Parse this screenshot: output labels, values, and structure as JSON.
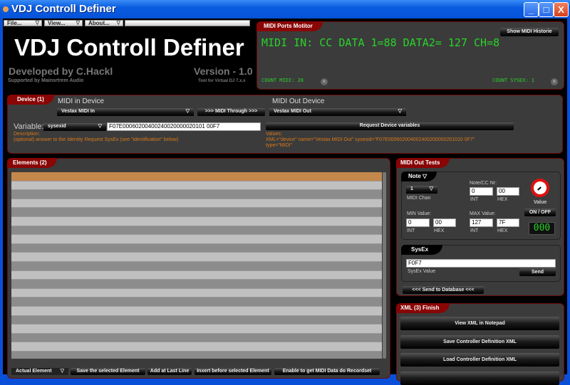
{
  "window": {
    "title": "VDJ Controll Definer",
    "minimize": "_",
    "maximize": "□",
    "close": "X"
  },
  "menu": {
    "items": [
      {
        "label": "File..."
      },
      {
        "label": "View..."
      },
      {
        "label": "About..."
      }
    ],
    "arrow": "▽"
  },
  "header": {
    "title": "VDJ Controll Definer",
    "developer": "Developed by C.Hackl",
    "version": "Version - 1.0",
    "supported": "Supported by Mainsrtrem Audio",
    "tool": "Tool for Virtual DJ 7.x.x"
  },
  "monitor": {
    "tab": "MIDI Ports Motitor",
    "history_button": "Show MIDI Historie",
    "lcd_text": "MIDI IN: CC DATA 1=88 DATA2= 127 CH=8",
    "count_midi": "COUNT MIDI: 28",
    "count_sysex": "COUNT SYSEX: 1",
    "clear_icon": "×"
  },
  "device": {
    "tab": "Device (1)",
    "midi_in_label": "MIDI in Device",
    "midi_in_value": "Vestax MIDI In",
    "through_button": ">>> MIDI Through >>>",
    "midi_out_label": "MIDI Out Device",
    "midi_out_value": "Vestax MIDI Out",
    "variable_label": "Variable:",
    "variable_value": "sysexid",
    "variable_input": "F07E00060200400240020000020101 00F7",
    "request_button": "Request Device variables",
    "description_label": "Description:",
    "description": "(optional) answer to the Identity Request SysEx (see \"identification\" below)",
    "values_label": "Values:",
    "values_line1": "XML=\"device\"   name=\"Vestax MIDI Out\"   sysexid=\"F07E000602004002400200000201010 0F7\"",
    "values_line2": "type=\"MIDI\""
  },
  "elements": {
    "tab": "Elements (2)",
    "selected_color": "#c4884c",
    "bottom": {
      "actual": "Actual Element",
      "save": "Save the selected Element",
      "add": "Add at Last Line",
      "insert": "Inxert before selected Element",
      "enable": "Enable to get MIDI Data do Recordset"
    }
  },
  "tests": {
    "tab": "MIDI Out Tests",
    "note_tab": "Note",
    "chan_value": "1",
    "chan_label": "MIDI Chan",
    "note_nr_label": "Note/CC Nr:",
    "note_int": "0",
    "note_hex": "00",
    "int": "INT",
    "hex": "HEX",
    "min_label": "MIN Value:",
    "min_int": "0",
    "min_hex": "00",
    "max_label": "MAX Value:",
    "max_int": "127",
    "max_hex": "7F",
    "value_label": "Value",
    "onoff": "ON / OFF",
    "value_display": "000",
    "sysex_tab": "SysEx",
    "sysex_value": "F0F7",
    "sysex_label": "SysEx Value",
    "send": "Send",
    "send_db": "<<< Send to Database <<<"
  },
  "xml": {
    "tab": "XML (3) Finish",
    "view": "View XML in Notepad",
    "save": "Save Controller Definition XML",
    "load": "Load Controller Definition XML"
  }
}
